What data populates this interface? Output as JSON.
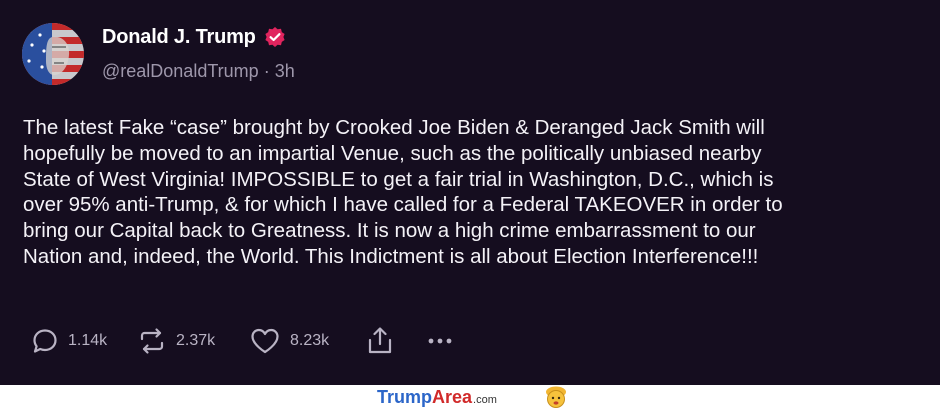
{
  "post": {
    "author_name": "Donald J. Trump",
    "handle": "@realDonaldTrump",
    "separator": "·",
    "time_ago": "3h",
    "body_lines": [
      "The latest Fake “case” brought by Crooked Joe Biden & Deranged Jack Smith will",
      "hopefully be moved to an impartial Venue, such as the politically unbiased nearby",
      "State of West Virginia! IMPOSSIBLE to get a fair trial in Washington, D.C., which is",
      "over 95% anti-Trump, & for which I have called for a Federal TAKEOVER in order to",
      "bring our Capital back to Greatness. It is now a high crime embarrassment to our",
      "Nation and, indeed, the World. This Indictment is all about Election Interference!!!"
    ],
    "verified_badge_color": "#e0245e",
    "background_color": "#150d1f"
  },
  "actions": {
    "replies": "1.14k",
    "reposts": "2.37k",
    "likes": "8.23k",
    "reply_icon": "comment-icon",
    "repost_icon": "repost-icon",
    "like_icon": "heart-icon",
    "share_icon": "share-icon",
    "more_icon": "more-icon"
  },
  "watermark": {
    "brand_part1": "Trump",
    "brand_part2": "Area",
    "brand_suffix": ".com",
    "colors": {
      "trump": "#2c66c9",
      "area": "#d12a2a"
    }
  }
}
